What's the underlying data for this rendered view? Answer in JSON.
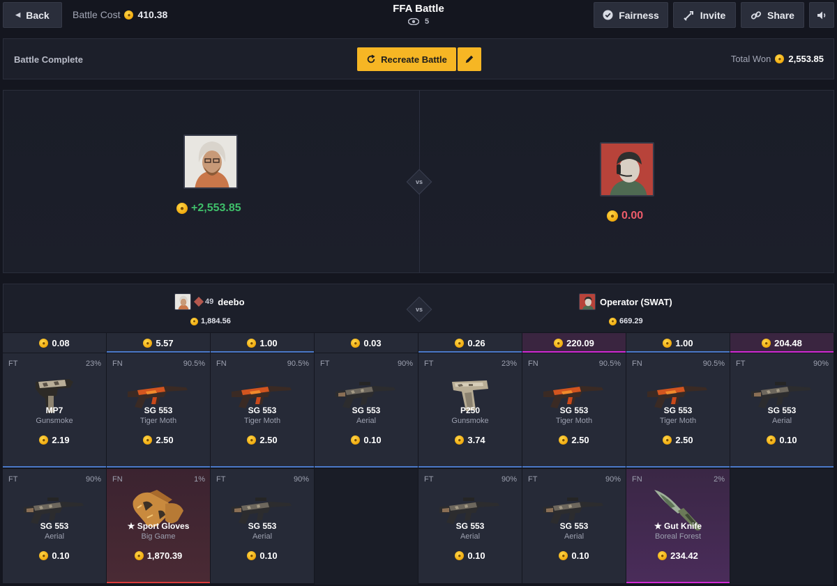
{
  "header": {
    "back_label": "Back",
    "cost_label": "Battle Cost",
    "cost_value": "410.38",
    "title": "FFA Battle",
    "watchers": "5",
    "fairness_label": "Fairness",
    "invite_label": "Invite",
    "share_label": "Share"
  },
  "status": {
    "label": "Battle Complete",
    "recreate_label": "Recreate Battle",
    "total_label": "Total Won",
    "total_value": "2,553.85"
  },
  "arena": {
    "vs": "vs",
    "left_result": "+2,553.85",
    "right_result": "0.00"
  },
  "players": [
    {
      "name": "deebo",
      "level": "49",
      "value": "1,884.56"
    },
    {
      "name": "Operator (SWAT)",
      "value": "669.29"
    }
  ],
  "colors": {
    "accent": "#f6b624",
    "win": "#3fbf6a",
    "lose": "#ef5c6a",
    "blue": "#4b79c9",
    "red": "#d93b3b",
    "magenta": "#d02ad4"
  },
  "columns": [
    {
      "total": "0.08",
      "highlight": false,
      "line": "none"
    },
    {
      "total": "5.57",
      "highlight": false,
      "line": "blue"
    },
    {
      "total": "1.00",
      "highlight": false,
      "line": "blue"
    },
    {
      "total": "0.03",
      "highlight": false,
      "line": "none"
    },
    {
      "total": "0.26",
      "highlight": false,
      "line": "blue"
    },
    {
      "total": "220.09",
      "highlight": true,
      "line": "magenta"
    },
    {
      "total": "1.00",
      "highlight": false,
      "line": "blue"
    },
    {
      "total": "204.48",
      "highlight": true,
      "line": "magenta"
    }
  ],
  "row1": [
    {
      "cond": "FT",
      "pct": "23%",
      "name": "MP7",
      "skin": "Gunsmoke",
      "price": "2.19",
      "icon": "smg-icon",
      "bar": "blue"
    },
    {
      "cond": "FN",
      "pct": "90.5%",
      "name": "SG 553",
      "skin": "Tiger Moth",
      "price": "2.50",
      "icon": "rifle-orange-icon",
      "bar": "blue"
    },
    {
      "cond": "FN",
      "pct": "90.5%",
      "name": "SG 553",
      "skin": "Tiger Moth",
      "price": "2.50",
      "icon": "rifle-orange-icon",
      "bar": "blue"
    },
    {
      "cond": "FT",
      "pct": "90%",
      "name": "SG 553",
      "skin": "Aerial",
      "price": "0.10",
      "icon": "rifle-grey-icon",
      "bar": "blue"
    },
    {
      "cond": "FT",
      "pct": "23%",
      "name": "P250",
      "skin": "Gunsmoke",
      "price": "3.74",
      "icon": "pistol-icon",
      "bar": "blue"
    },
    {
      "cond": "FN",
      "pct": "90.5%",
      "name": "SG 553",
      "skin": "Tiger Moth",
      "price": "2.50",
      "icon": "rifle-orange-icon",
      "bar": "blue"
    },
    {
      "cond": "FN",
      "pct": "90.5%",
      "name": "SG 553",
      "skin": "Tiger Moth",
      "price": "2.50",
      "icon": "rifle-orange-icon",
      "bar": "blue"
    },
    {
      "cond": "FT",
      "pct": "90%",
      "name": "SG 553",
      "skin": "Aerial",
      "price": "0.10",
      "icon": "rifle-grey-icon",
      "bar": "blue"
    }
  ],
  "row2": [
    {
      "cond": "FT",
      "pct": "90%",
      "name": "SG 553",
      "skin": "Aerial",
      "price": "0.10",
      "icon": "rifle-grey-icon",
      "bar": "none",
      "style": ""
    },
    {
      "cond": "FN",
      "pct": "1%",
      "name": "★ Sport Gloves",
      "skin": "Big Game",
      "price": "1,870.39",
      "icon": "gloves-icon",
      "bar": "red",
      "style": "rare"
    },
    {
      "cond": "FT",
      "pct": "90%",
      "name": "SG 553",
      "skin": "Aerial",
      "price": "0.10",
      "icon": "rifle-grey-icon",
      "bar": "none",
      "style": ""
    },
    null,
    {
      "cond": "FT",
      "pct": "90%",
      "name": "SG 553",
      "skin": "Aerial",
      "price": "0.10",
      "icon": "rifle-grey-icon",
      "bar": "none",
      "style": ""
    },
    {
      "cond": "FT",
      "pct": "90%",
      "name": "SG 553",
      "skin": "Aerial",
      "price": "0.10",
      "icon": "rifle-grey-icon",
      "bar": "none",
      "style": ""
    },
    {
      "cond": "FN",
      "pct": "2%",
      "name": "★ Gut Knife",
      "skin": "Boreal Forest",
      "price": "234.42",
      "icon": "knife-icon",
      "bar": "magenta",
      "style": "purple"
    },
    null
  ]
}
